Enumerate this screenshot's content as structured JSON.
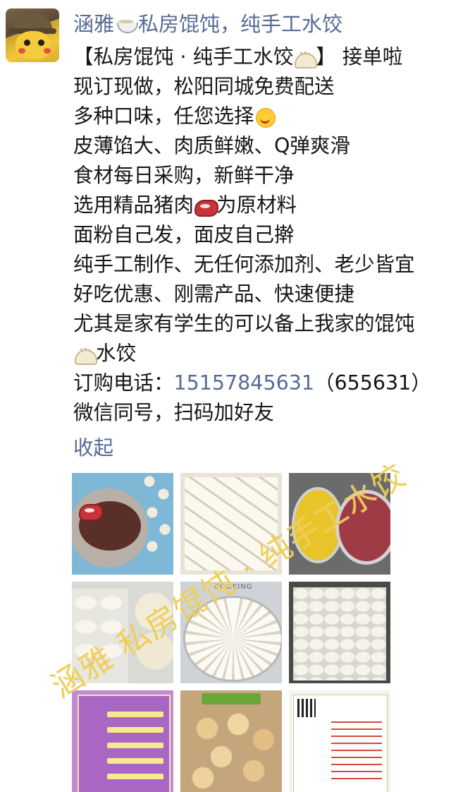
{
  "moment": {
    "author_name": "涵雅",
    "author_name_suffix": "私房馄饨，纯手工水饺",
    "lines": [
      [
        "【私房馄饨 · 纯手工水饺",
        "】 接单啦"
      ],
      [
        "现订现做，松阳同城免费配送"
      ],
      [
        "多种口味，任您选择"
      ],
      [
        "皮薄馅大、肉质鲜嫩、Q弹爽滑"
      ],
      [
        "食材每日采购，新鲜干净"
      ],
      [
        "选用精品猪肉",
        "为原材料"
      ],
      [
        "面粉自己发，面皮自己擀"
      ],
      [
        "纯手工制作、无任何添加剂、老少皆宜"
      ],
      [
        "好吃优惠、刚需产品、快速便捷"
      ],
      [
        "尤其是家有学生的可以备上我家的馄饨"
      ],
      [
        "水饺"
      ]
    ],
    "order_phone_label": "订购电话：",
    "order_phone": "15157845631",
    "order_phone_short": "（655631）",
    "wechat_line": "微信同号，扫码加好友",
    "collapse_label": "收起",
    "watermark": "涵雅 私房馄饨 · 纯手工水饺",
    "thumb_texts": {
      "t5_label": "COOKING"
    }
  }
}
